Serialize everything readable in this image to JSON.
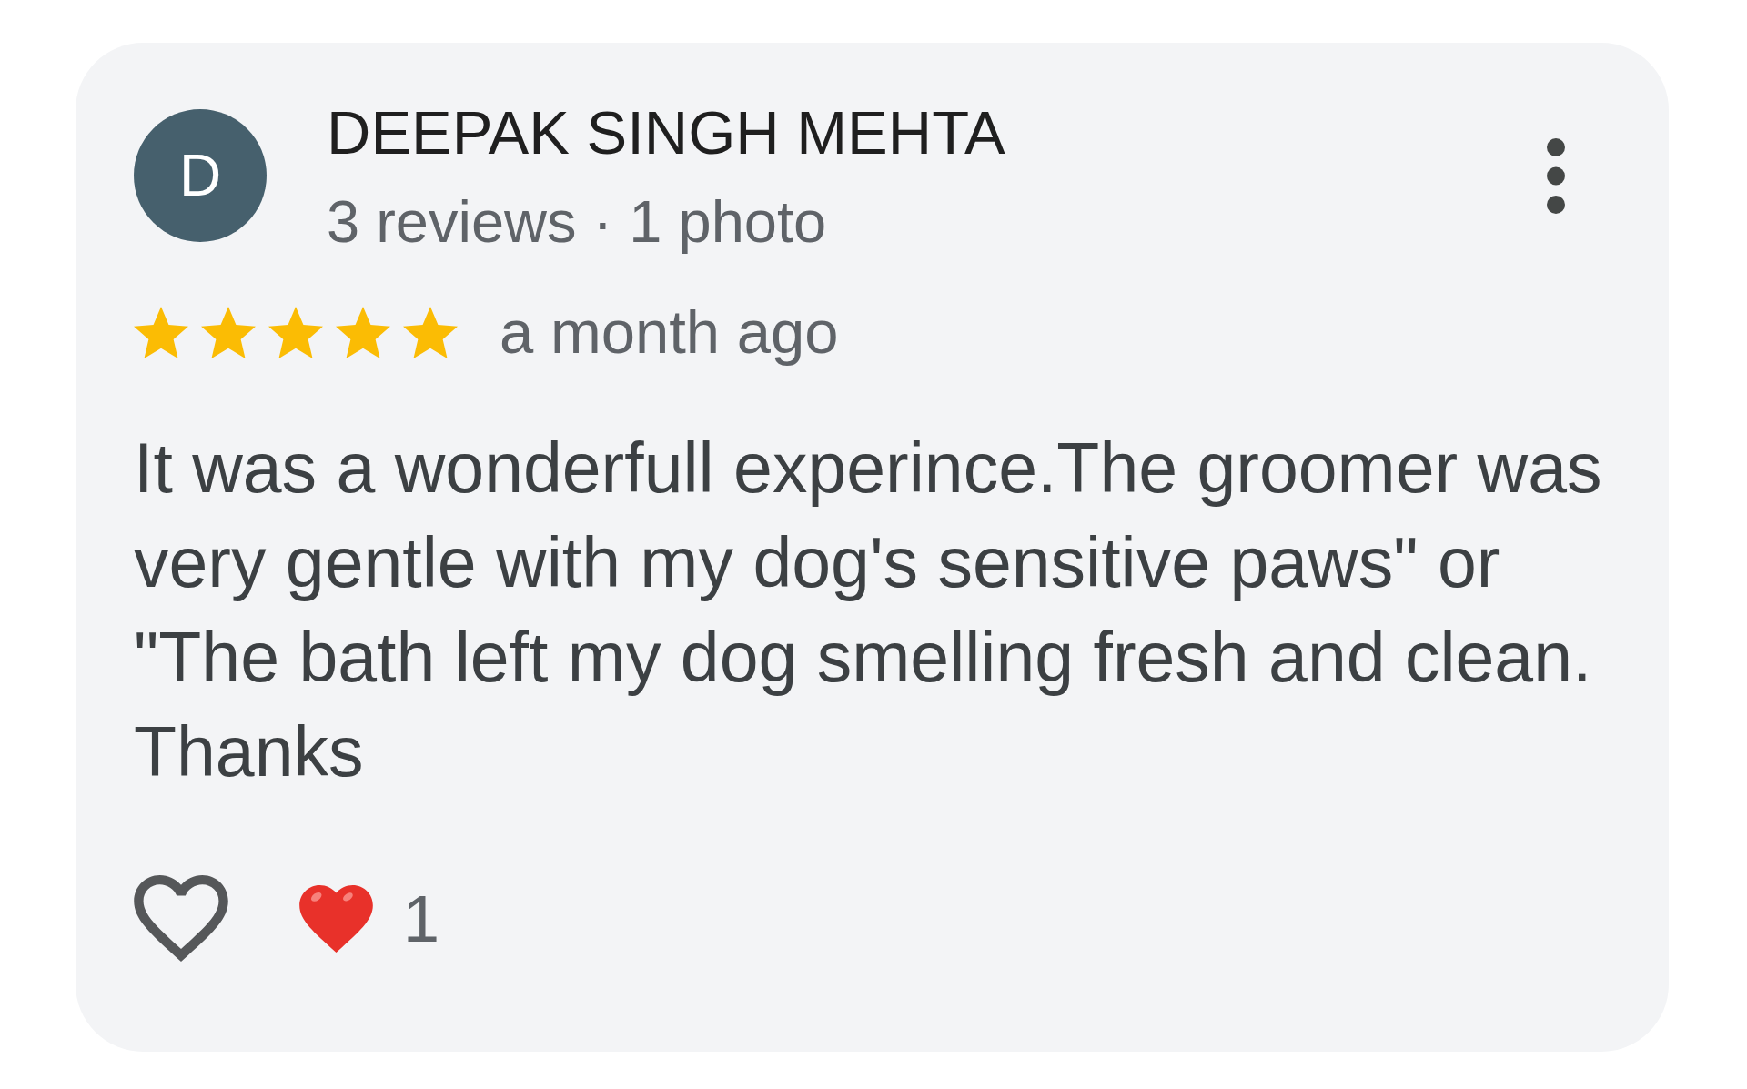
{
  "review": {
    "author": {
      "initial": "D",
      "name": "DEEPAK SINGH MEHTA",
      "meta": "3 reviews · 1 photo"
    },
    "stars": 5,
    "time": "a month ago",
    "text": "It was a wonderfull experince.The groomer was very gentle with my dog's sensitive paws\" or \"The bath left my dog smelling fresh and clean. Thanks",
    "liked": false,
    "reactions": [
      {
        "count": "1"
      }
    ]
  }
}
